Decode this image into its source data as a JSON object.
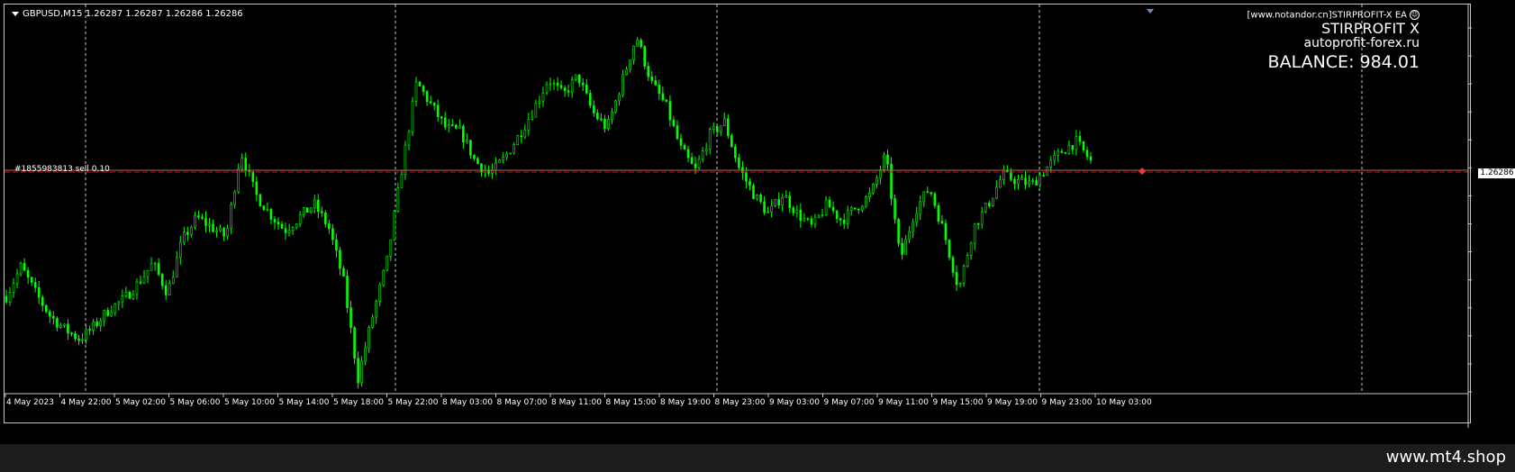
{
  "chart": {
    "symbol_label": "GBPUSD,M15  1.26287 1.26287 1.26286 1.26286",
    "order_label": "#1855983813 sell 0.10",
    "current_price": "1.26286"
  },
  "ea": {
    "site": "[www.notandor.cn]STIRPROFIT-X EA",
    "name": "STIRPROFIT X",
    "url": "autoprofit-forex.ru",
    "balance": "BALANCE: 984.01"
  },
  "footer": {
    "text": "www.mt4.shop"
  },
  "colors": {
    "background": "#000000",
    "candles": "#00ff00",
    "grid": "#c8c8c8",
    "order_line": "#ff0000"
  },
  "chart_data": {
    "type": "line",
    "title": "GBPUSD,M15",
    "price_axis": [
      "1.26685",
      "1.26600",
      "1.26515",
      "1.26430",
      "1.26345",
      "1.26260",
      "1.26175",
      "1.26090",
      "1.26005",
      "1.25920",
      "1.25835",
      "1.25750",
      "1.25665",
      "1.25580"
    ],
    "time_axis": [
      "4 May 2023",
      "4 May 22:00",
      "5 May 02:00",
      "5 May 06:00",
      "5 May 10:00",
      "5 May 14:00",
      "5 May 18:00",
      "5 May 22:00",
      "8 May 03:00",
      "8 May 07:00",
      "8 May 11:00",
      "8 May 15:00",
      "8 May 19:00",
      "8 May 23:00",
      "9 May 03:00",
      "9 May 07:00",
      "9 May 11:00",
      "9 May 15:00",
      "9 May 19:00",
      "9 May 23:00",
      "10 May 03:00"
    ],
    "ylim": [
      1.2558,
      1.26685
    ],
    "close_path": [
      1.2587,
      1.2596,
      1.2588,
      1.2581,
      1.2577,
      1.2574,
      1.2578,
      1.2583,
      1.2586,
      1.2591,
      1.2597,
      1.2588,
      1.2604,
      1.2611,
      1.2608,
      1.2605,
      1.2631,
      1.2618,
      1.2612,
      1.2607,
      1.2611,
      1.2615,
      1.2608,
      1.2592,
      1.2562,
      1.2581,
      1.2598,
      1.2626,
      1.2652,
      1.2645,
      1.2638,
      1.2637,
      1.2628,
      1.2624,
      1.2629,
      1.2636,
      1.2644,
      1.2653,
      1.2648,
      1.2654,
      1.2643,
      1.2638,
      1.2652,
      1.2666,
      1.2652,
      1.2645,
      1.2632,
      1.2625,
      1.2636,
      1.264,
      1.2626,
      1.2618,
      1.2612,
      1.2618,
      1.2612,
      1.2608,
      1.2615,
      1.261,
      1.2614,
      1.2618,
      1.263,
      1.2598,
      1.2613,
      1.262,
      1.2606,
      1.2589,
      1.2608,
      1.2615,
      1.2624,
      1.2622,
      1.2621,
      1.2626,
      1.2631,
      1.2634,
      1.2628
    ]
  }
}
